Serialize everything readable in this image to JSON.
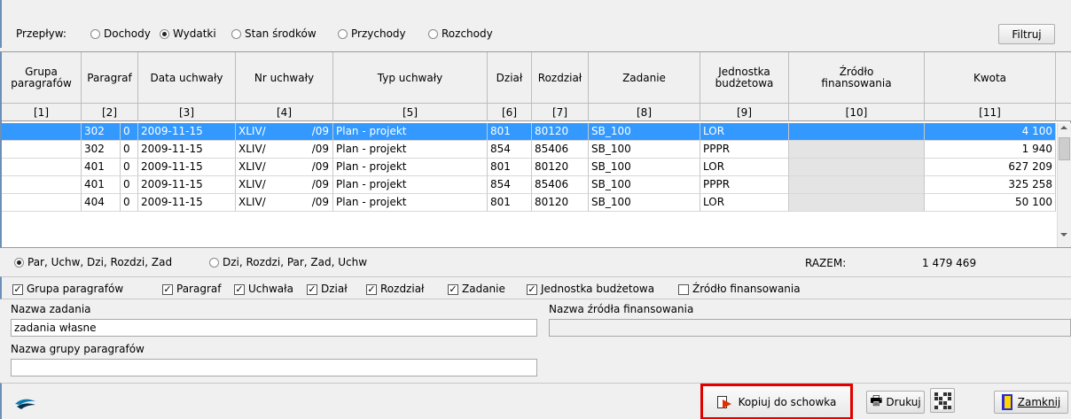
{
  "filter_bar": {
    "label": "Przepływ:",
    "options": [
      {
        "label": "Dochody",
        "selected": false
      },
      {
        "label": "Wydatki",
        "selected": true
      },
      {
        "label": "Stan środków",
        "selected": false
      },
      {
        "label": "Przychody",
        "selected": false
      },
      {
        "label": "Rozchody",
        "selected": false
      }
    ],
    "filter_button": "Filtruj"
  },
  "table": {
    "columns": [
      {
        "header": "Grupa paragrafów",
        "num": "[1]"
      },
      {
        "header": "Paragraf",
        "num": "[2]"
      },
      {
        "header": "Data uchwały",
        "num": "[3]"
      },
      {
        "header": "Nr uchwały",
        "num": "[4]"
      },
      {
        "header": "Typ uchwały",
        "num": "[5]"
      },
      {
        "header": "Dział",
        "num": "[6]"
      },
      {
        "header": "Rozdział",
        "num": "[7]"
      },
      {
        "header": "Zadanie",
        "num": "[8]"
      },
      {
        "header": "Jednostka budżetowa",
        "num": "[9]"
      },
      {
        "header": "Źródło finansowania",
        "num": "[10]"
      },
      {
        "header": "Kwota",
        "num": "[11]"
      }
    ],
    "rows": [
      {
        "grupa": "",
        "paragraf": "302",
        "sub": "0",
        "data": "2009-11-15",
        "nr1": "XLIV/",
        "nr2": "/09",
        "typ": "Plan - projekt",
        "dzial": "801",
        "rozdzial": "80120",
        "zadanie": "SB_100",
        "jednostka": "LOR",
        "zrodlo": "",
        "kwota": "4 100",
        "selected": true
      },
      {
        "grupa": "",
        "paragraf": "302",
        "sub": "0",
        "data": "2009-11-15",
        "nr1": "XLIV/",
        "nr2": "/09",
        "typ": "Plan - projekt",
        "dzial": "854",
        "rozdzial": "85406",
        "zadanie": "SB_100",
        "jednostka": "PPPR",
        "zrodlo": "",
        "kwota": "1 940",
        "selected": false
      },
      {
        "grupa": "",
        "paragraf": "401",
        "sub": "0",
        "data": "2009-11-15",
        "nr1": "XLIV/",
        "nr2": "/09",
        "typ": "Plan - projekt",
        "dzial": "801",
        "rozdzial": "80120",
        "zadanie": "SB_100",
        "jednostka": "LOR",
        "zrodlo": "",
        "kwota": "627 209",
        "selected": false
      },
      {
        "grupa": "",
        "paragraf": "401",
        "sub": "0",
        "data": "2009-11-15",
        "nr1": "XLIV/",
        "nr2": "/09",
        "typ": "Plan - projekt",
        "dzial": "854",
        "rozdzial": "85406",
        "zadanie": "SB_100",
        "jednostka": "PPPR",
        "zrodlo": "",
        "kwota": "325 258",
        "selected": false
      },
      {
        "grupa": "",
        "paragraf": "404",
        "sub": "0",
        "data": "2009-11-15",
        "nr1": "XLIV/",
        "nr2": "/09",
        "typ": "Plan - projekt",
        "dzial": "801",
        "rozdzial": "80120",
        "zadanie": "SB_100",
        "jednostka": "LOR",
        "zrodlo": "",
        "kwota": "50 100",
        "selected": false
      }
    ]
  },
  "sort": {
    "options": [
      {
        "label": "Par, Uchw, Dzi, Rozdzi, Zad",
        "selected": true
      },
      {
        "label": "Dzi, Rozdzi, Par, Zad, Uchw",
        "selected": false
      }
    ],
    "total_label": "RAZEM:",
    "total_value": "1 479 469"
  },
  "visible_columns": [
    {
      "label": "Grupa paragrafów",
      "checked": true
    },
    {
      "label": "Paragraf",
      "checked": true
    },
    {
      "label": "Uchwała",
      "checked": true
    },
    {
      "label": "Dział",
      "checked": true
    },
    {
      "label": "Rozdział",
      "checked": true
    },
    {
      "label": "Zadanie",
      "checked": true
    },
    {
      "label": "Jednostka budżetowa",
      "checked": true
    },
    {
      "label": "Źródło finansowania",
      "checked": false
    }
  ],
  "details": {
    "task_name_label": "Nazwa zadania",
    "task_name_value": "zadania własne",
    "group_name_label": "Nazwa grupy paragrafów",
    "group_name_value": "",
    "source_name_label": "Nazwa źródła finansowania",
    "source_name_value": ""
  },
  "footer": {
    "copy_button": "Kopiuj do schowka",
    "print_button": "Drukuj",
    "close_button": "Zamknij",
    "highlight_color": "#e00000"
  }
}
